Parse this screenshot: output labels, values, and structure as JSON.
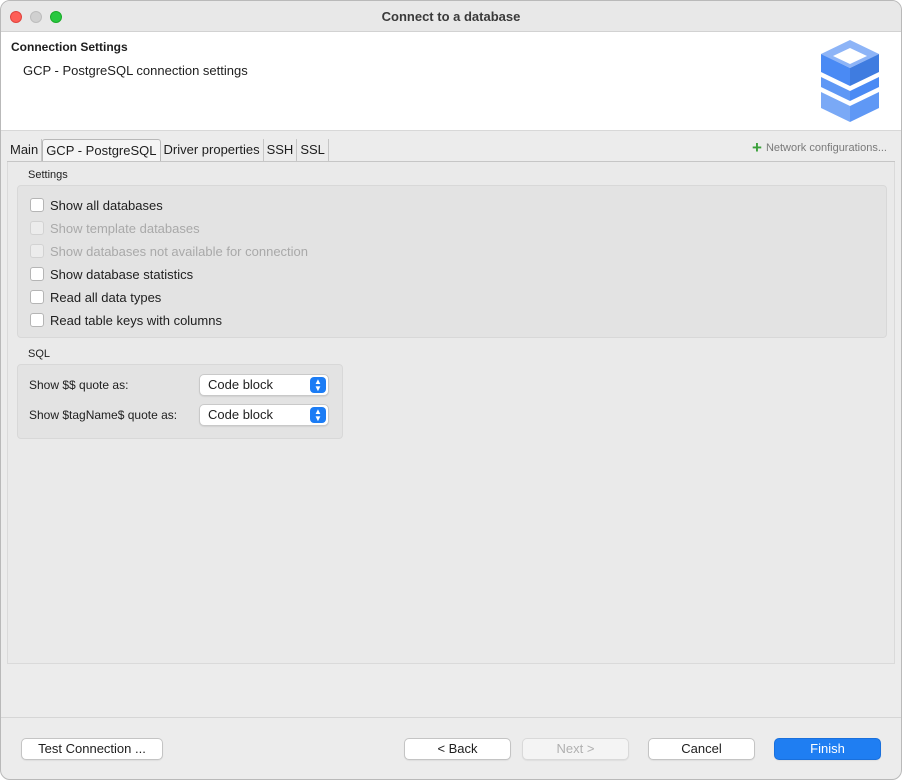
{
  "window": {
    "title": "Connect to a database"
  },
  "header": {
    "title": "Connection Settings",
    "subtitle": "GCP - PostgreSQL connection settings",
    "logo_icon": "gcp-database-stack-icon",
    "logo_color": "#4a8af4"
  },
  "tabs": [
    {
      "label": "Main"
    },
    {
      "label": "GCP - PostgreSQL",
      "active": true
    },
    {
      "label": "Driver properties"
    },
    {
      "label": "SSH"
    },
    {
      "label": "SSL"
    }
  ],
  "network_config": {
    "label": "Network configurations...",
    "icon": "plus-icon"
  },
  "settings": {
    "group_label": "Settings",
    "options": [
      {
        "label": "Show all databases",
        "checked": false,
        "enabled": true
      },
      {
        "label": "Show template databases",
        "checked": false,
        "enabled": false
      },
      {
        "label": "Show databases not available for connection",
        "checked": false,
        "enabled": false
      },
      {
        "label": "Show database statistics",
        "checked": false,
        "enabled": true
      },
      {
        "label": "Read all data types",
        "checked": false,
        "enabled": true
      },
      {
        "label": "Read table keys with columns",
        "checked": false,
        "enabled": true
      }
    ]
  },
  "sql": {
    "group_label": "SQL",
    "dollar_quote_label": "Show $$ quote as:",
    "dollar_quote_value": "Code block",
    "tag_quote_label": "Show $tagName$ quote as:",
    "tag_quote_value": "Code block"
  },
  "footer": {
    "test_connection": "Test Connection ...",
    "back": "< Back",
    "next": "Next >",
    "cancel": "Cancel",
    "finish": "Finish"
  },
  "colors": {
    "accent": "#1f7ef2",
    "network_plus": "#3aa03a"
  }
}
